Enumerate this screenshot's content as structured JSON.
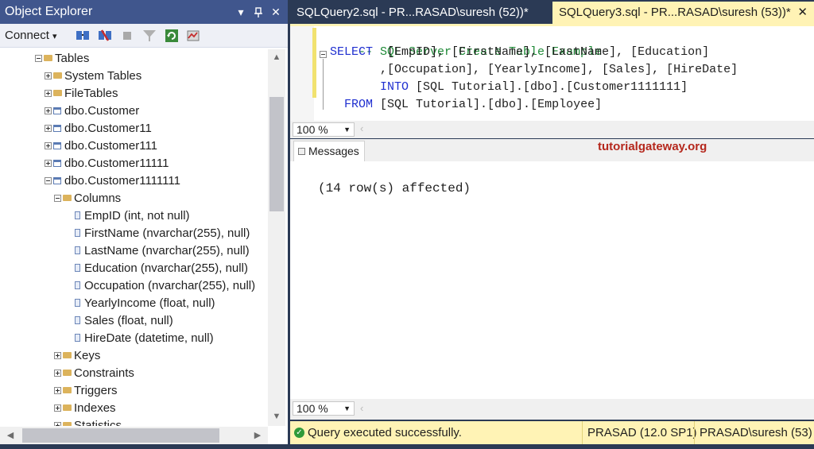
{
  "object_explorer": {
    "title": "Object Explorer",
    "pin_icon": "pin-icon",
    "close_label": "✕",
    "dropdown_label": "▾",
    "connect_label": "Connect",
    "connect_arrow": "▾",
    "tree": [
      {
        "label": "Tables",
        "type": "folder",
        "expanded": true
      },
      {
        "label": "System Tables",
        "type": "folder",
        "expanded": false
      },
      {
        "label": "FileTables",
        "type": "folder",
        "expanded": false
      },
      {
        "label": "dbo.Customer",
        "type": "table",
        "expanded": false
      },
      {
        "label": "dbo.Customer11",
        "type": "table",
        "expanded": false
      },
      {
        "label": "dbo.Customer111",
        "type": "table",
        "expanded": false
      },
      {
        "label": "dbo.Customer11111",
        "type": "table",
        "expanded": false
      },
      {
        "label": "dbo.Customer1111111",
        "type": "table",
        "expanded": true
      },
      {
        "label": "Columns",
        "type": "folder",
        "expanded": true
      },
      {
        "label": "EmpID (int, not null)",
        "type": "column"
      },
      {
        "label": "FirstName (nvarchar(255), null)",
        "type": "column"
      },
      {
        "label": "LastName (nvarchar(255), null)",
        "type": "column"
      },
      {
        "label": "Education (nvarchar(255), null)",
        "type": "column"
      },
      {
        "label": "Occupation (nvarchar(255), null)",
        "type": "column"
      },
      {
        "label": "YearlyIncome (float, null)",
        "type": "column"
      },
      {
        "label": "Sales (float, null)",
        "type": "column"
      },
      {
        "label": "HireDate (datetime, null)",
        "type": "column"
      },
      {
        "label": "Keys",
        "type": "folder",
        "expanded": false
      },
      {
        "label": "Constraints",
        "type": "folder",
        "expanded": false
      },
      {
        "label": "Triggers",
        "type": "folder",
        "expanded": false
      },
      {
        "label": "Indexes",
        "type": "folder",
        "expanded": false
      },
      {
        "label": "Statistics",
        "type": "folder",
        "expanded": false
      }
    ]
  },
  "tabs": [
    {
      "label": "SQLQuery2.sql - PR...RASAD\\suresh (52))*",
      "active": false
    },
    {
      "label": "SQLQuery3.sql - PR...RASAD\\suresh (53))*",
      "active": true
    }
  ],
  "tab_close": "✕",
  "editor": {
    "comment": "-- SQL Server Create Table Example",
    "select_kw": "SELECT",
    "line1_rest": "  [EmpID], [FirstName], [LastName], [Education]",
    "line2": "       ,[Occupation], [YearlyIncome], [Sales], [HireDate]",
    "into_kw": "INTO",
    "line3_rest": " [SQL Tutorial].[dbo].[Customer1111111]",
    "from_kw": "FROM",
    "line4_rest": " [SQL Tutorial].[dbo].[Employee]"
  },
  "zoom": {
    "top": "100 %",
    "bottom": "100 %"
  },
  "results": {
    "messages_tab": "Messages",
    "watermark": "tutorialgateway.org",
    "message": "(14 row(s) affected)"
  },
  "status": {
    "text": "Query executed successfully.",
    "server": "PRASAD (12.0 SP1)",
    "user": "PRASAD\\suresh (53)"
  },
  "colors": {
    "title_bar": "#40568d",
    "active_tab": "#fff3b5",
    "keyword": "#1f2fd0",
    "comment": "#1f8a37",
    "brand": "#b5281d"
  }
}
